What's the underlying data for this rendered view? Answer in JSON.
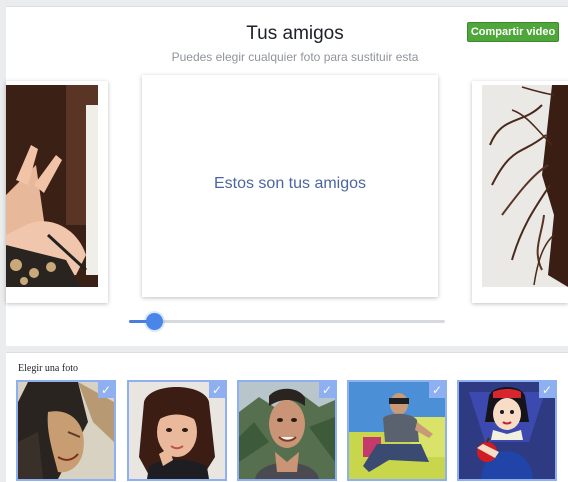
{
  "header": {
    "title": "Tus amigos",
    "subtitle": "Puedes elegir cualquier foto para sustituir esta",
    "share_button": "Compartir video"
  },
  "carousel": {
    "center_message": "Estos son tus amigos",
    "slider_value": 0.08
  },
  "chooser": {
    "label": "Elegir una foto",
    "check_glyph": "✓",
    "thumbnails": [
      {
        "name": "thumb-illustrated-warrior"
      },
      {
        "name": "thumb-woman-selfie"
      },
      {
        "name": "thumb-man-mountains"
      },
      {
        "name": "thumb-man-sofa"
      },
      {
        "name": "thumb-snow-white"
      }
    ]
  },
  "colors": {
    "accent": "#4a86e8",
    "share_green": "#4fa63b",
    "message_blue": "#4b669f"
  }
}
